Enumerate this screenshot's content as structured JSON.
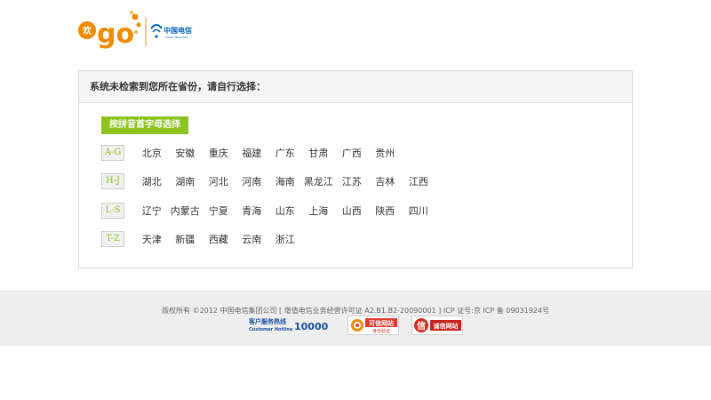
{
  "header": {
    "logo_label": "欢go",
    "brand_cn": "中国电信",
    "brand_en": "CHINA TELECOM"
  },
  "panel": {
    "title": "系统未检索到您所在省份，请自行选择：",
    "mode_button": "按拼音首字母选择",
    "groups": [
      {
        "label": "A-G",
        "provinces": [
          "北京",
          "安徽",
          "重庆",
          "福建",
          "广东",
          "甘肃",
          "广西",
          "贵州"
        ]
      },
      {
        "label": "H-J",
        "provinces": [
          "湖北",
          "湖南",
          "河北",
          "河南",
          "海南",
          "黑龙江",
          "江苏",
          "吉林",
          "江西"
        ]
      },
      {
        "label": "L-S",
        "provinces": [
          "辽宁",
          "内蒙古",
          "宁夏",
          "青海",
          "山东",
          "上海",
          "山西",
          "陕西",
          "四川"
        ]
      },
      {
        "label": "T-Z",
        "provinces": [
          "天津",
          "新疆",
          "西藏",
          "云南",
          "浙江"
        ]
      }
    ]
  },
  "footer": {
    "copyright": "版权所有 ©2012 中国电信集团公司 [ 增值电信业务经营许可证 A2.B1.B2-20090001 ] ICP 证号:京 ICP 备 09031924号",
    "hotline_cn": "客户服务热线",
    "hotline_en": "Customer Hotline",
    "hotline_number": "10000",
    "trust_title": "可信网站",
    "trust_sub": "身份验证",
    "cred_char": "信",
    "cred_label": "诚信网站"
  },
  "colors": {
    "accent_green": "#8cc31f",
    "logo_orange": "#f08a00",
    "telecom_blue": "#0063b8"
  }
}
